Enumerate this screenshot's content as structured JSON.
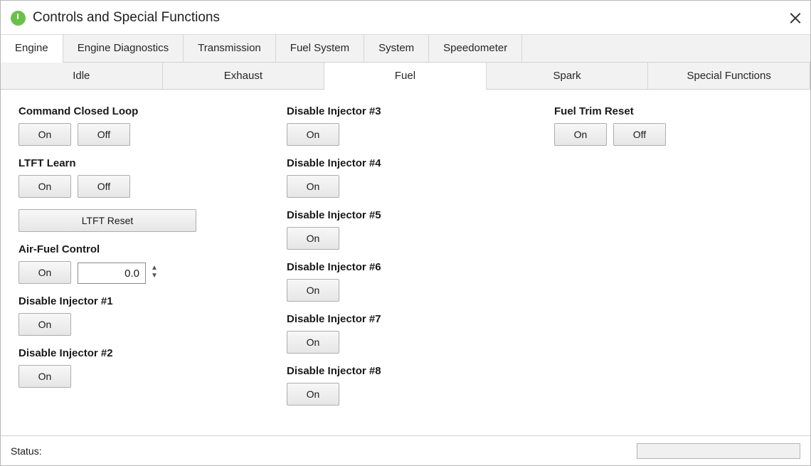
{
  "window": {
    "title": "Controls and Special Functions",
    "icon": "power-icon",
    "accent_color": "#6cc04a"
  },
  "main_tabs": [
    {
      "label": "Engine",
      "active": true
    },
    {
      "label": "Engine Diagnostics",
      "active": false
    },
    {
      "label": "Transmission",
      "active": false
    },
    {
      "label": "Fuel System",
      "active": false
    },
    {
      "label": "System",
      "active": false
    },
    {
      "label": "Speedometer",
      "active": false
    }
  ],
  "sub_tabs": [
    {
      "label": "Idle",
      "active": false
    },
    {
      "label": "Exhaust",
      "active": false
    },
    {
      "label": "Fuel",
      "active": true
    },
    {
      "label": "Spark",
      "active": false
    },
    {
      "label": "Special Functions",
      "active": false
    }
  ],
  "controls": {
    "command_closed_loop": {
      "label": "Command Closed Loop",
      "on": "On",
      "off": "Off"
    },
    "ltft_learn": {
      "label": "LTFT Learn",
      "on": "On",
      "off": "Off"
    },
    "ltft_reset": {
      "label": "LTFT Reset"
    },
    "air_fuel_control": {
      "label": "Air-Fuel Control",
      "on": "On",
      "value": "0.0"
    },
    "injector_1": {
      "label": "Disable Injector #1",
      "on": "On"
    },
    "injector_2": {
      "label": "Disable Injector #2",
      "on": "On"
    },
    "injector_3": {
      "label": "Disable Injector #3",
      "on": "On"
    },
    "injector_4": {
      "label": "Disable Injector #4",
      "on": "On"
    },
    "injector_5": {
      "label": "Disable Injector #5",
      "on": "On"
    },
    "injector_6": {
      "label": "Disable Injector #6",
      "on": "On"
    },
    "injector_7": {
      "label": "Disable Injector #7",
      "on": "On"
    },
    "injector_8": {
      "label": "Disable Injector #8",
      "on": "On"
    },
    "fuel_trim_reset": {
      "label": "Fuel Trim Reset",
      "on": "On",
      "off": "Off"
    }
  },
  "status": {
    "label": "Status:",
    "progress": 0
  }
}
